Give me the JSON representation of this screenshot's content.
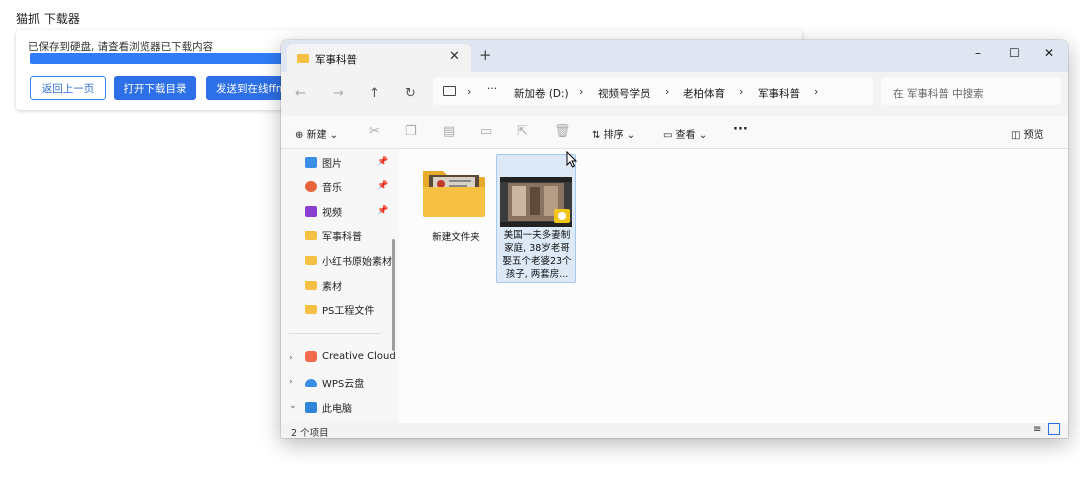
{
  "app": {
    "title": "猫抓 下载器"
  },
  "download": {
    "message": "已保存到硬盘, 请查看浏览器已下载内容",
    "progress": 1.0,
    "buttons": {
      "back": "返回上一页",
      "open_dir": "打开下载目录",
      "send": "发送到在线ffm"
    }
  },
  "explorer": {
    "tab_title": "军事科普",
    "window_controls": {
      "minimize": "–",
      "maximize": "☐",
      "close": "✕"
    },
    "breadcrumbs": [
      "新加卷 (D:)",
      "视频号学员",
      "老柏体育",
      "军事科普"
    ],
    "more": "···",
    "search_placeholder": "在 军事科普 中搜索",
    "toolbar": {
      "new": "新建",
      "sort": "排序",
      "view": "查看",
      "more": "···",
      "preview": "预览"
    },
    "sidebar": [
      {
        "label": "图片",
        "icon": "pictures-icon",
        "pinned": true
      },
      {
        "label": "音乐",
        "icon": "music-icon",
        "pinned": true
      },
      {
        "label": "视频",
        "icon": "videos-icon",
        "pinned": true
      },
      {
        "label": "军事科普",
        "icon": "folder-icon"
      },
      {
        "label": "小红书原始素材",
        "icon": "folder-icon"
      },
      {
        "label": "素材",
        "icon": "folder-icon"
      },
      {
        "label": "PS工程文件",
        "icon": "folder-icon"
      },
      {
        "label": "Creative Cloud",
        "icon": "creative-cloud-icon",
        "expandable": true
      },
      {
        "label": "WPS云盘",
        "icon": "cloud-icon",
        "expandable": true
      },
      {
        "label": "此电脑",
        "icon": "computer-icon",
        "expandable": true,
        "expanded": true
      }
    ],
    "items": [
      {
        "name": "新建文件夹",
        "type": "folder"
      },
      {
        "name_lines": [
          "美国一夫多妻制",
          "家庭, 38岁老哥",
          "娶五个老婆23个",
          "孩子, 两套房..."
        ],
        "type": "video"
      }
    ],
    "status": "2 个项目"
  },
  "colors": {
    "accent": "#2c6fe6",
    "folder": "#f6c042",
    "selection": "#dde9f7"
  }
}
